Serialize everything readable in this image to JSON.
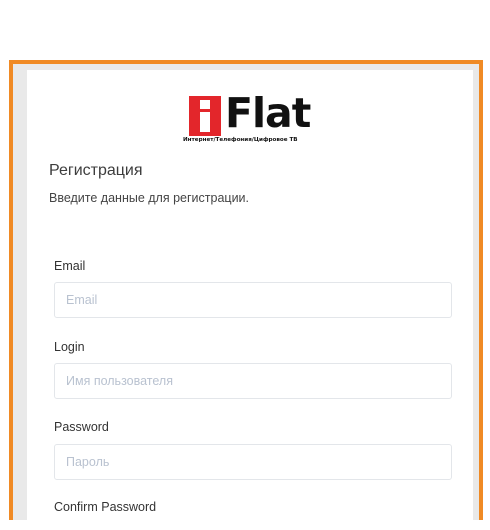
{
  "brand": {
    "name": "Flat",
    "tagline": "Интернет/Телефония/Цифровое ТВ",
    "colors": {
      "red": "#e3262b",
      "orange_border": "#f08a24"
    }
  },
  "form": {
    "title": "Регистрация",
    "subtitle": "Введите данные для регистрации.",
    "fields": {
      "email": {
        "label": "Email",
        "placeholder": "Email",
        "value": ""
      },
      "login": {
        "label": "Login",
        "placeholder": "Имя пользователя",
        "value": ""
      },
      "password": {
        "label": "Password",
        "placeholder": "Пароль",
        "value": ""
      },
      "confirm_password": {
        "label": "Confirm Password"
      }
    }
  }
}
